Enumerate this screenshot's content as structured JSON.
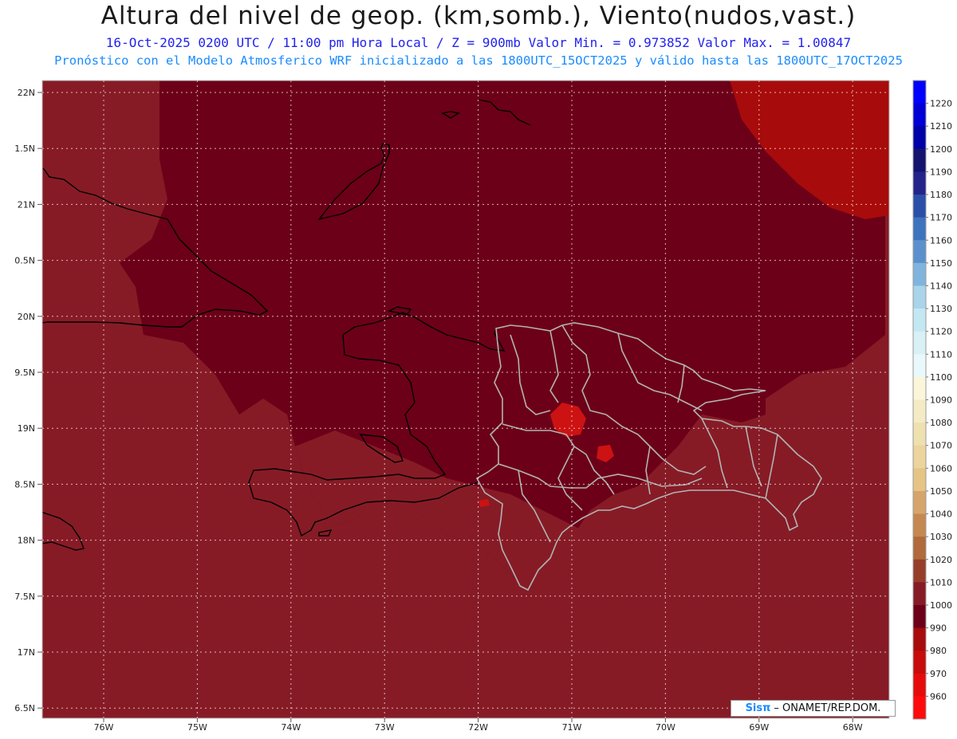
{
  "header": {
    "title": "Altura del nivel de geop. (km,somb.), Viento(nudos,vast.)",
    "subtitle1": "16-Oct-2025  0200 UTC / 11:00 pm Hora Local / Z = 900mb   Valor Min. = 0.973852  Valor Max. = 1.00847",
    "subtitle2": "Pronóstico con el Modelo Atmosferico WRF inicializado a las 1800UTC_15OCT2025 y válido hasta las  1800UTC_17OCT2025"
  },
  "map": {
    "lat_labels": [
      "22N",
      "1.5N",
      "21N",
      "0.5N",
      "20N",
      "9.5N",
      "19N",
      "8.5N",
      "18N",
      "7.5N",
      "17N",
      "6.5N"
    ],
    "lon_labels": [
      "76W",
      "75W",
      "74W",
      "73W",
      "72W",
      "71W",
      "70W",
      "69W",
      "68W"
    ],
    "colors": {
      "field_base": "#861b26",
      "field_low": "#6c0018",
      "field_high": "#a80b0b",
      "field_peak": "#cc1212",
      "coast": "#000000",
      "borders": "#b3b3b3",
      "grid": "#ffffff"
    }
  },
  "colorbar": {
    "levels": [
      1220,
      1210,
      1200,
      1190,
      1180,
      1170,
      1160,
      1150,
      1140,
      1130,
      1120,
      1110,
      1100,
      1090,
      1080,
      1070,
      1060,
      1050,
      1040,
      1030,
      1020,
      1010,
      1000,
      990,
      980,
      970,
      960
    ],
    "colors": [
      "#0000ff",
      "#0000d6",
      "#0000a8",
      "#14146e",
      "#23238c",
      "#2b4fa8",
      "#3c73bf",
      "#5a91cd",
      "#80b4dc",
      "#a9d4ea",
      "#c4e8f2",
      "#d8f0f6",
      "#e8f8fb",
      "#fbf5da",
      "#f4ebc4",
      "#efe0b0",
      "#ecd49c",
      "#e5c486",
      "#d6a56b",
      "#c68851",
      "#b06a3b",
      "#963e2a",
      "#861b26",
      "#6c0018",
      "#a80b0b",
      "#c80b0b",
      "#e50b0b",
      "#ff0a0a"
    ]
  },
  "credit": {
    "brand": "Sisπ",
    "org": "– ONAMET/REP.DOM."
  }
}
